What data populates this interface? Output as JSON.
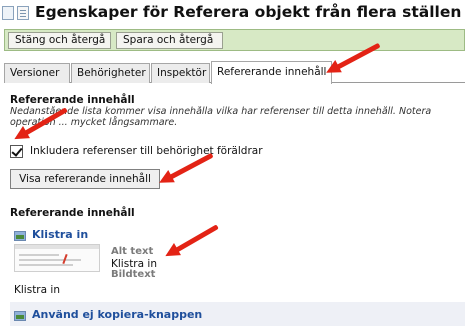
{
  "window": {
    "title": "Egenskaper för Referera objekt från flera ställen"
  },
  "toolbar": {
    "close_label": "Stäng och återgå",
    "save_label": "Spara och återgå"
  },
  "tabs": [
    {
      "label": "Versioner"
    },
    {
      "label": "Behörigheter"
    },
    {
      "label": "Inspektör"
    },
    {
      "label": "Refererande innehåll",
      "selected": true
    }
  ],
  "content": {
    "section_heading": "Refererande innehåll",
    "description_line1": "Nedanstående lista kommer visa innehålla vilka har referenser till detta innehåll. Notera",
    "description_line2": "operation ... mycket långsammare.",
    "checkbox_label": "Inkludera referenser till behörighet föräldrar",
    "checkbox_checked": true,
    "show_button_label": "Visa refererande innehåll",
    "results_heading": "Refererande innehåll",
    "items": [
      {
        "title": "Klistra in",
        "alt_label": "Alt text",
        "alt_value": "Klistra in",
        "caption_label": "Bildtext",
        "caption": "Klistra in"
      },
      {
        "title": "Använd ej kopiera-knappen"
      }
    ]
  },
  "colors": {
    "toolbar_bg": "#d7e9c5",
    "link_blue": "#1f4f9c",
    "annotation_red": "#e32315"
  }
}
